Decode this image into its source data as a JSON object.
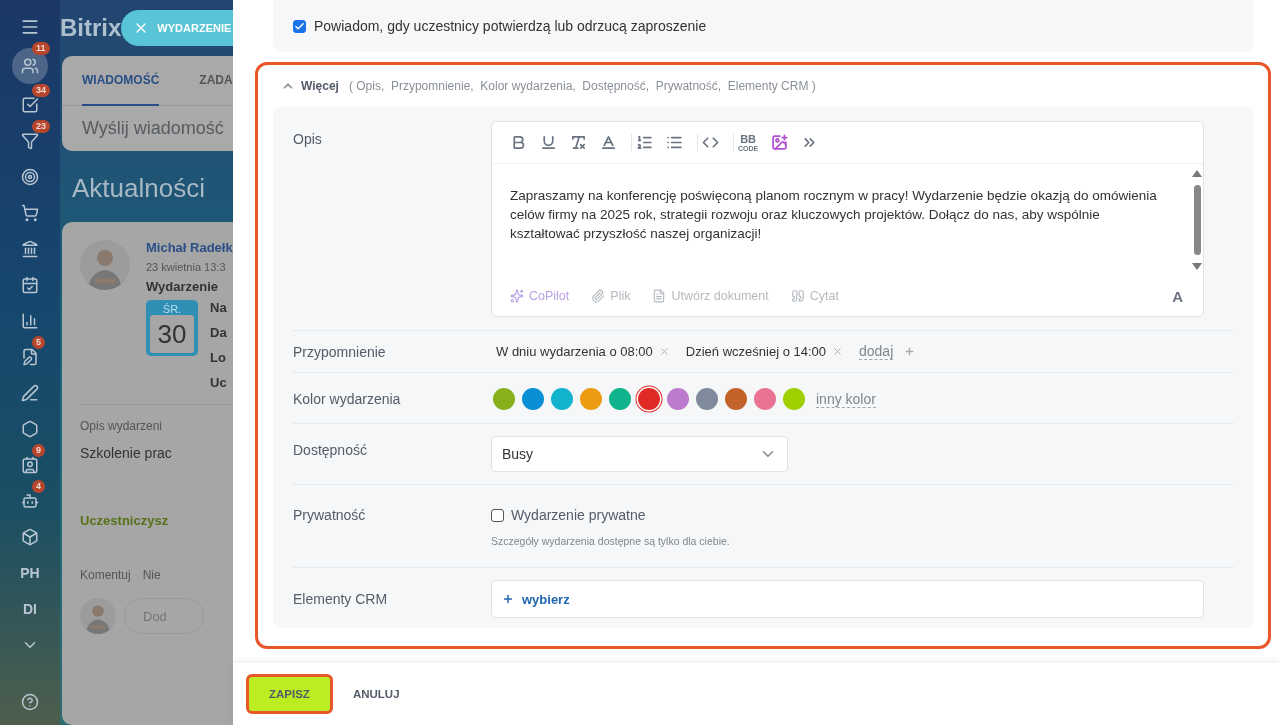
{
  "sidebar": {
    "items": [
      {
        "kind": "icon",
        "badge": "11"
      },
      {
        "kind": "icon",
        "badge": "34"
      },
      {
        "kind": "icon",
        "badge": "23"
      },
      {
        "kind": "icon"
      },
      {
        "kind": "icon"
      },
      {
        "kind": "icon"
      },
      {
        "kind": "icon"
      },
      {
        "kind": "icon"
      },
      {
        "kind": "icon",
        "badge": "5"
      },
      {
        "kind": "icon"
      },
      {
        "kind": "icon"
      },
      {
        "kind": "icon",
        "badge": "9"
      },
      {
        "kind": "icon",
        "badge": "4"
      },
      {
        "kind": "icon"
      },
      {
        "kind": "text",
        "label": "PH"
      },
      {
        "kind": "text",
        "label": "DI"
      },
      {
        "kind": "icon"
      }
    ]
  },
  "background": {
    "logo": "Bitrix",
    "close_tab": {
      "label": "WYDARZENIE"
    },
    "composer": {
      "tabs": [
        {
          "label": "WIADOMOŚĆ",
          "selected": true
        },
        {
          "label": "ZADA",
          "selected": false
        }
      ],
      "placeholder": "Wyślij wiadomość"
    },
    "heading": "Aktualności",
    "post": {
      "author": "Michał Radełk",
      "time": "23 kwietnia 13:3",
      "type": "Wydarzenie",
      "weekday": "ŚR.",
      "day": "30",
      "fields": [
        "Na",
        "Da",
        "Lo",
        "Uc"
      ],
      "description_label": "Opis wydarzeni",
      "description": "Szkolenie prac",
      "status": "Uczestniczysz",
      "actions": [
        "Komentuj",
        "Nie"
      ],
      "comment_placeholder": "Dod"
    }
  },
  "panel": {
    "notify": {
      "label": "Powiadom, gdy uczestnicy potwierdzą lub odrzucą zaproszenie",
      "checked": true
    },
    "more": {
      "label": "Więcej",
      "expanded": true,
      "highlighted": true,
      "summary": "( Opis,  Przypomnienie,  Kolor wydarzenia,  Dostępność,  Prywatność,  Elementy CRM )"
    },
    "description": {
      "label": "Opis",
      "toolbar": [
        [
          {
            "kind": "icon"
          },
          {
            "kind": "icon"
          },
          {
            "kind": "icon"
          },
          {
            "kind": "icon"
          }
        ],
        [
          {
            "kind": "icon"
          },
          {
            "kind": "icon"
          }
        ],
        [
          {
            "kind": "icon"
          }
        ],
        [
          {
            "kind": "bbcode",
            "label": "BB",
            "sub": "CODE"
          },
          {
            "kind": "icon"
          },
          {
            "kind": "icon"
          }
        ]
      ],
      "text": "Zapraszamy na konferencję poświęconą planom rocznym w pracy! Wydarzenie będzie okazją do omówienia celów firmy na 2025 rok, strategii rozwoju oraz kluczowych projektów. Dołącz do nas, aby wspólnie kształtować przyszłość naszej organizacji!",
      "footer": [
        "CoPilot",
        "Plik",
        "Utwórz dokument",
        "Cytat"
      ],
      "format_toggle": "A"
    },
    "reminder": {
      "label": "Przypomnienie",
      "items": [
        "W dniu wydarzenia o 08:00",
        "Dzień wcześniej o 14:00"
      ],
      "add": "dodaj"
    },
    "color": {
      "label": "Kolor wydarzenia",
      "options": [
        {
          "color": "#86b01c",
          "selected": false
        },
        {
          "color": "#0a8fd4",
          "selected": false
        },
        {
          "color": "#13b3cd",
          "selected": false
        },
        {
          "color": "#ec9c12",
          "selected": false
        },
        {
          "color": "#10b48c",
          "selected": false
        },
        {
          "color": "#e02a26",
          "selected": true
        },
        {
          "color": "#bc7bcc",
          "selected": false
        },
        {
          "color": "#7f8b9c",
          "selected": false
        },
        {
          "color": "#c4622c",
          "selected": false
        },
        {
          "color": "#ea7394",
          "selected": false
        },
        {
          "color": "#9ed000",
          "selected": false
        }
      ],
      "other": "inny kolor"
    },
    "availability": {
      "label": "Dostępność",
      "value": "Busy"
    },
    "privacy": {
      "label": "Prywatność",
      "checkbox": {
        "label": "Wydarzenie prywatne",
        "checked": false
      },
      "hint": "Szczegóły wydarzenia dostępne są tylko dla ciebie."
    },
    "crm": {
      "label": "Elementy CRM",
      "action": "wybierz"
    }
  },
  "footer": {
    "buttons": [
      {
        "kind": "primary",
        "label": "ZAPISZ",
        "highlighted": true
      },
      {
        "kind": "link",
        "label": "ANULUJ"
      }
    ]
  }
}
